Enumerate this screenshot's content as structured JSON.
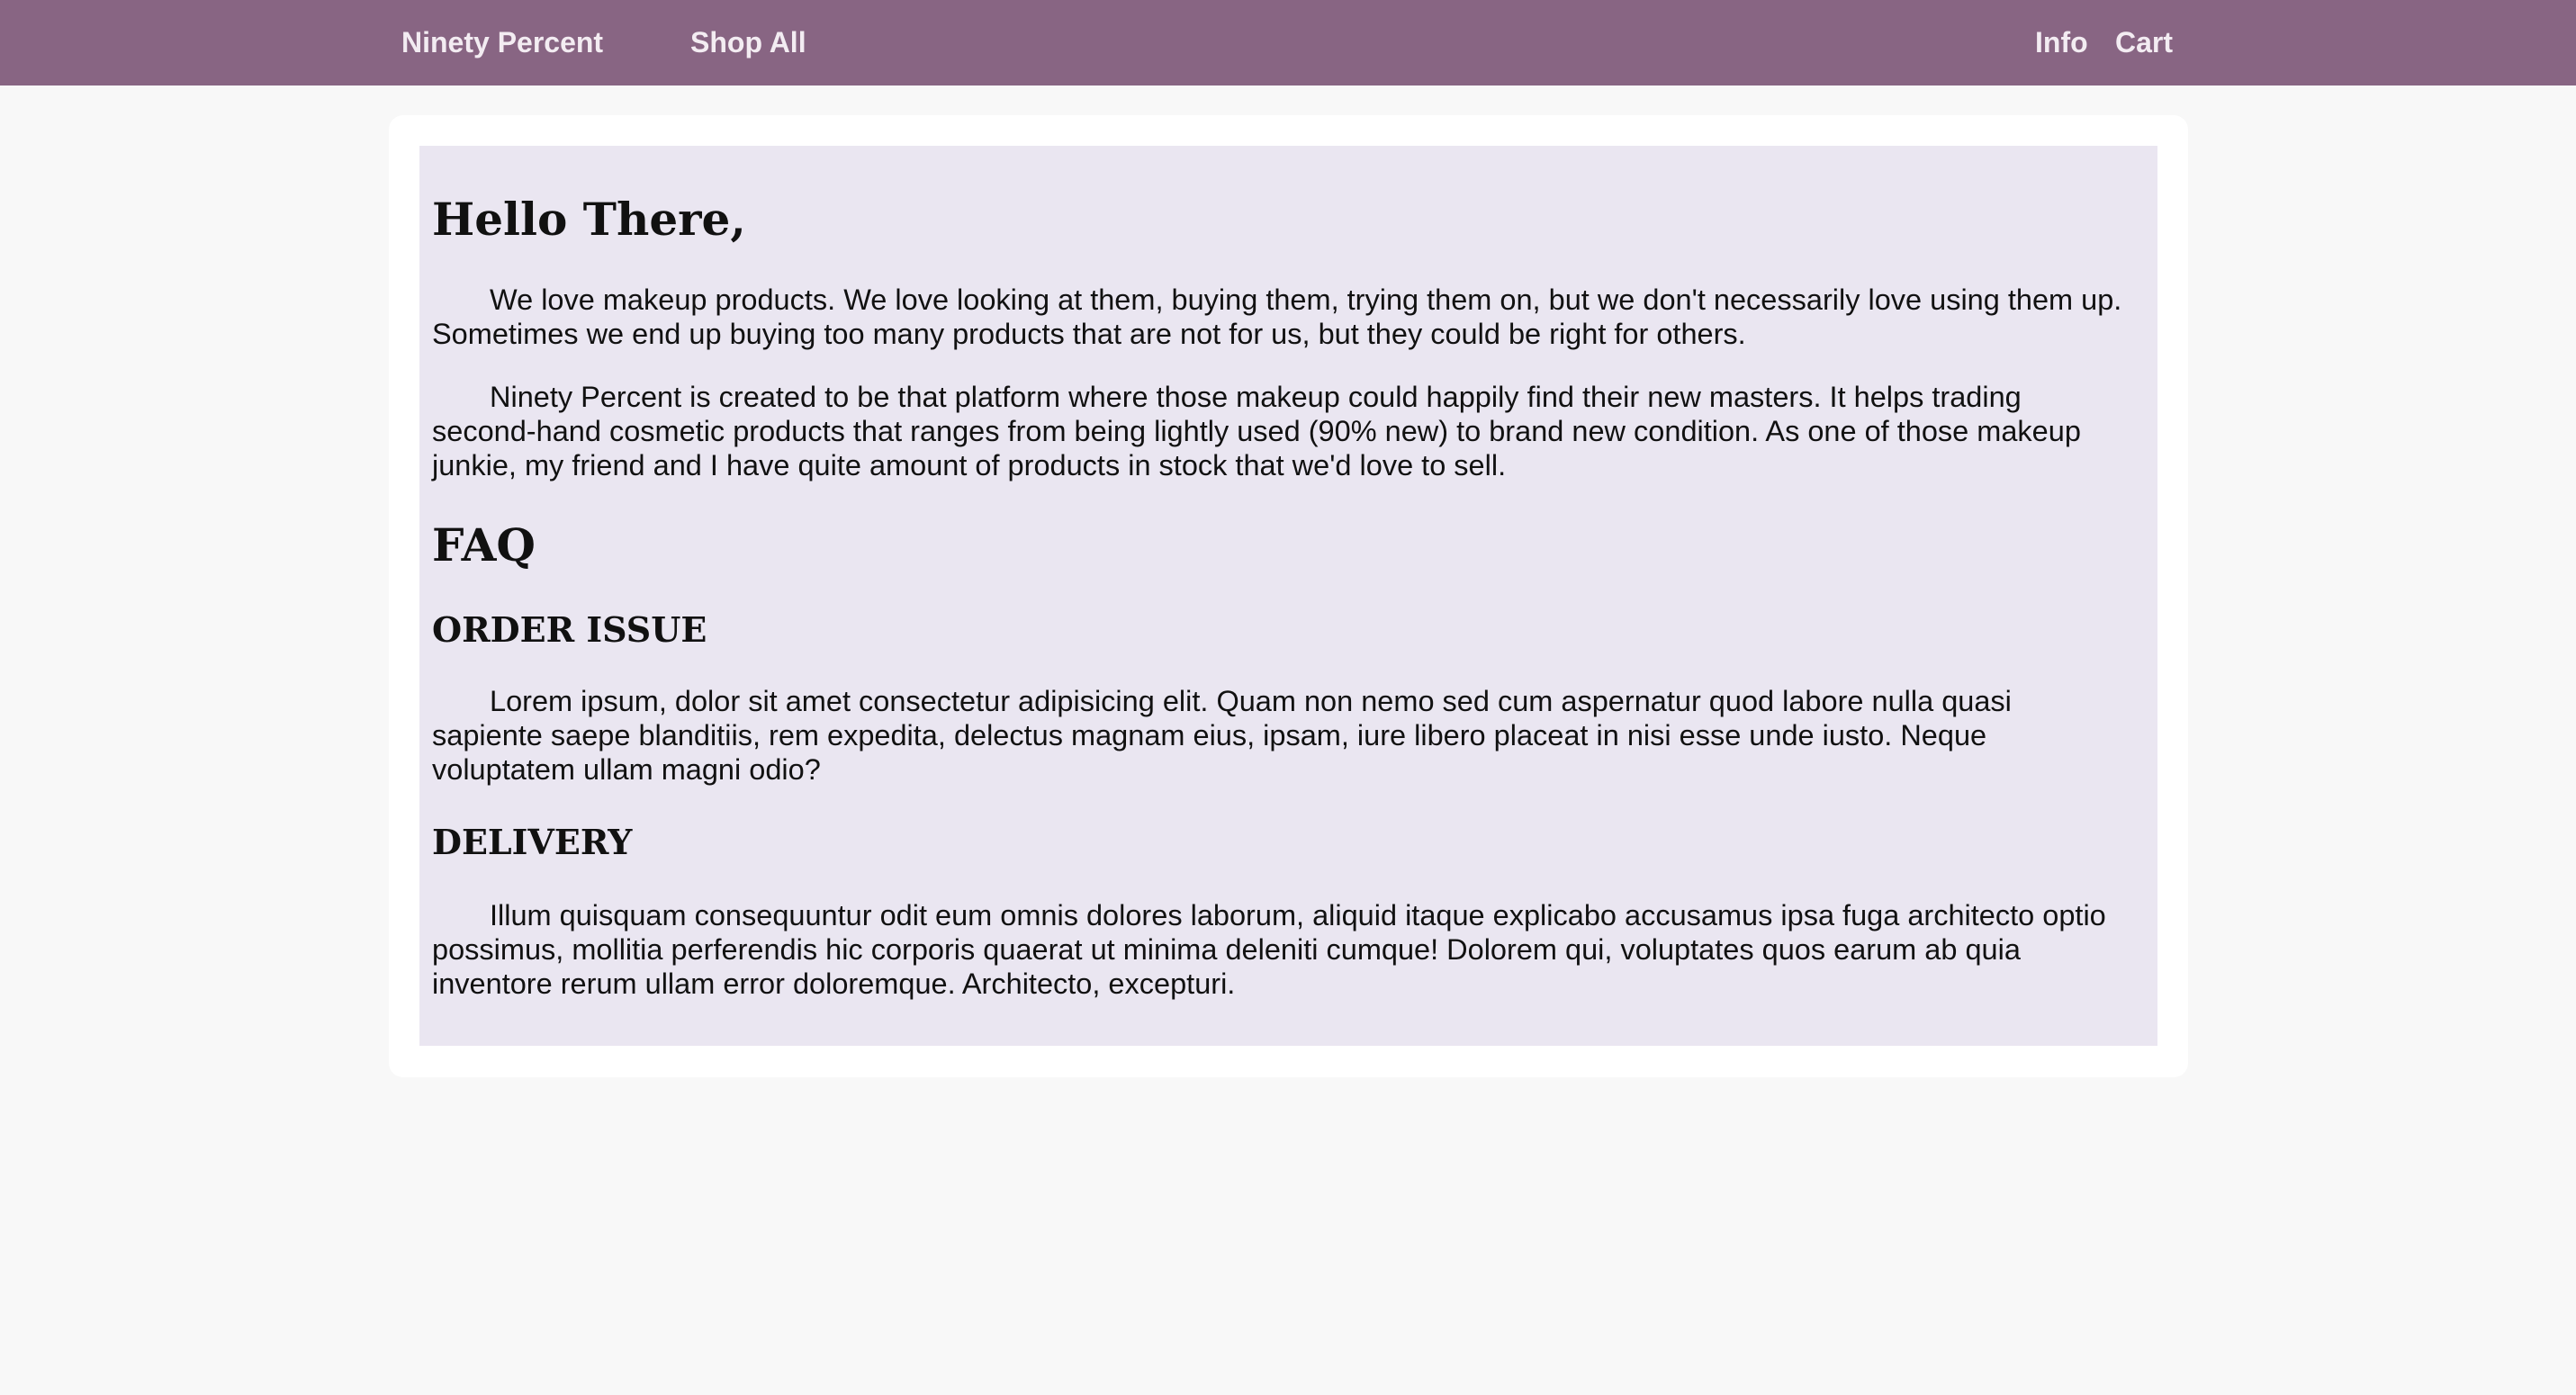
{
  "nav": {
    "brand": "Ninety Percent",
    "shop_all": "Shop All",
    "info": "Info",
    "cart": "Cart"
  },
  "colors": {
    "navbar_bg": "#886583",
    "content_bg": "#eae6f1",
    "page_bg": "#f8f8f8"
  },
  "info_page": {
    "greeting": "Hello There,",
    "intro": [
      "We love makeup products. We love looking at them, buying them, trying them on, but we don't necessarily love using them up. Sometimes we end up buying too many products that are not for us, but they could be right for others.",
      "Ninety Percent is created to be that platform where those makeup could happily find their new masters. It helps trading second-hand cosmetic products that ranges from being lightly used (90% new) to brand new condition. As one of those makeup junkie, my friend and I have quite amount of products in stock that we'd love to sell."
    ],
    "faq_title": "FAQ",
    "faq": [
      {
        "heading": "ORDER ISSUE",
        "body": "Lorem ipsum, dolor sit amet consectetur adipisicing elit. Quam non nemo sed cum aspernatur quod labore nulla quasi sapiente saepe blanditiis, rem expedita, delectus magnam eius, ipsam, iure libero placeat in nisi esse unde iusto. Neque voluptatem ullam magni odio?"
      },
      {
        "heading": "DELIVERY",
        "body": "Illum quisquam consequuntur odit eum omnis dolores laborum, aliquid itaque explicabo accusamus ipsa fuga architecto optio possimus, mollitia perferendis hic corporis quaerat ut minima deleniti cumque! Dolorem qui, voluptates quos earum ab quia inventore rerum ullam error doloremque. Architecto, excepturi."
      }
    ]
  }
}
